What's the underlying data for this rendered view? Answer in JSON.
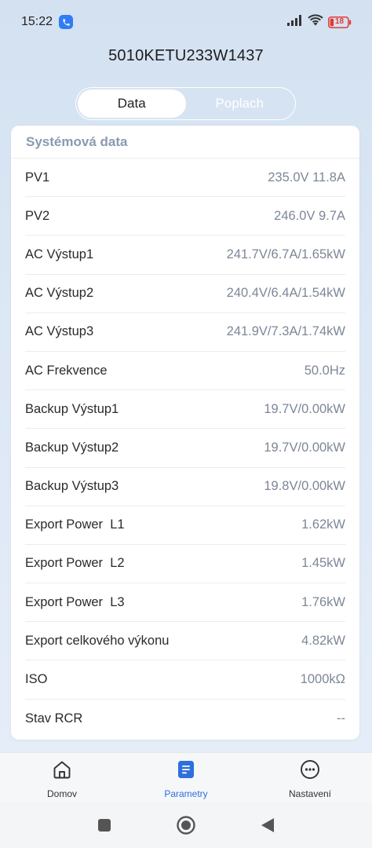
{
  "status_bar": {
    "time": "15:22",
    "battery_level": "18",
    "icons": [
      "phone-call-icon",
      "signal-icon",
      "wifi-icon",
      "battery-icon"
    ]
  },
  "header": {
    "device_serial": "5010KETU233W1437"
  },
  "segment": {
    "tabs": [
      {
        "label": "Data",
        "active": true
      },
      {
        "label": "Poplach",
        "active": false
      }
    ]
  },
  "card": {
    "title": "Systémová data",
    "rows": [
      {
        "label": "PV1",
        "value": "235.0V 11.8A"
      },
      {
        "label": "PV2",
        "value": "246.0V 9.7A"
      },
      {
        "label": "AC Výstup1",
        "value": "241.7V/6.7A/1.65kW"
      },
      {
        "label": "AC Výstup2",
        "value": "240.4V/6.4A/1.54kW"
      },
      {
        "label": "AC Výstup3",
        "value": "241.9V/7.3A/1.74kW"
      },
      {
        "label": "AC Frekvence",
        "value": "50.0Hz"
      },
      {
        "label": "Backup Výstup1",
        "value": "19.7V/0.00kW"
      },
      {
        "label": "Backup Výstup2",
        "value": "19.7V/0.00kW"
      },
      {
        "label": "Backup Výstup3",
        "value": "19.8V/0.00kW"
      },
      {
        "label": "Export Power  L1",
        "value": "1.62kW"
      },
      {
        "label": "Export Power  L2",
        "value": "1.45kW"
      },
      {
        "label": "Export Power  L3",
        "value": "1.76kW"
      },
      {
        "label": "Export celkového výkonu",
        "value": "4.82kW"
      },
      {
        "label": "ISO",
        "value": "1000kΩ"
      },
      {
        "label": "Stav RCR",
        "value": "--"
      }
    ]
  },
  "bottom_nav": {
    "items": [
      {
        "label": "Domov",
        "icon": "home-icon",
        "active": false
      },
      {
        "label": "Parametry",
        "icon": "document-list-icon",
        "active": true
      },
      {
        "label": "Nastavení",
        "icon": "more-dots-icon",
        "active": false
      }
    ]
  },
  "colors": {
    "accent": "#2f6fdd",
    "value_text": "#7d8797",
    "header_text": "#8a9ab0",
    "battery_low": "#e53935"
  }
}
